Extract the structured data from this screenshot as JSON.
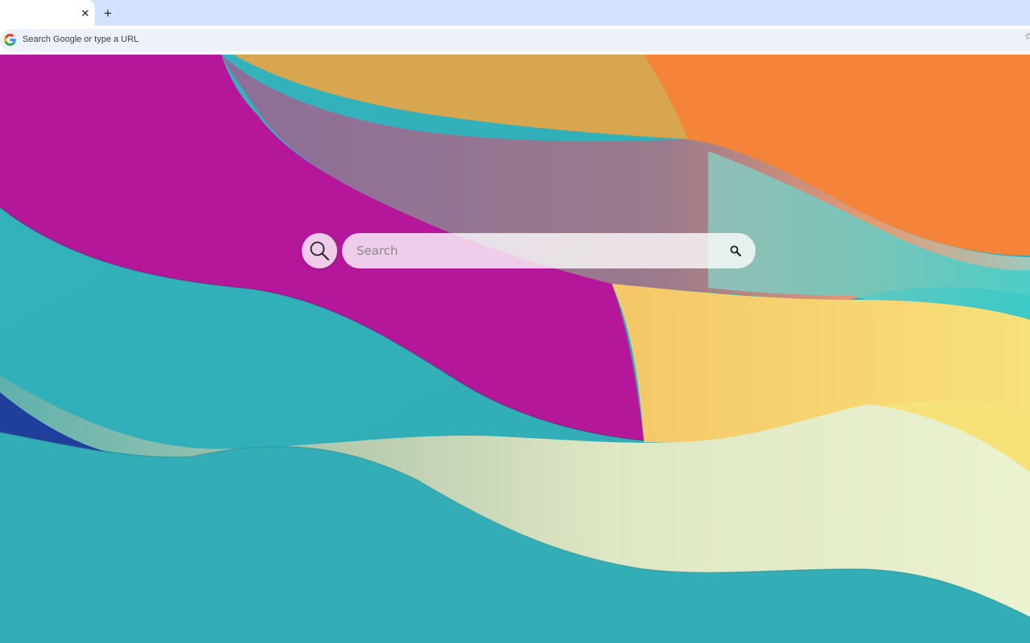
{
  "browser": {
    "tab": {
      "title": "",
      "close_glyph": "✕"
    },
    "new_tab_glyph": "+",
    "omnibox": {
      "text": "Search Google or type a URL",
      "icon": "google-g-icon"
    },
    "bookmark_glyph": "☆"
  },
  "page": {
    "search": {
      "placeholder": "Search",
      "logo_icon": "magnifier-logo-icon",
      "button_icon": "search-icon"
    },
    "wallpaper": {
      "description_colors": {
        "magenta": "#b5179a",
        "orange": "#f5843a",
        "gold": "#d8a84e",
        "teal": "#35b0b8",
        "yellow": "#f5d36a",
        "cream": "#e4ecc6"
      }
    }
  },
  "colors": {
    "tabstrip": "#d3e3fd",
    "omnibox": "#edf2fa"
  }
}
